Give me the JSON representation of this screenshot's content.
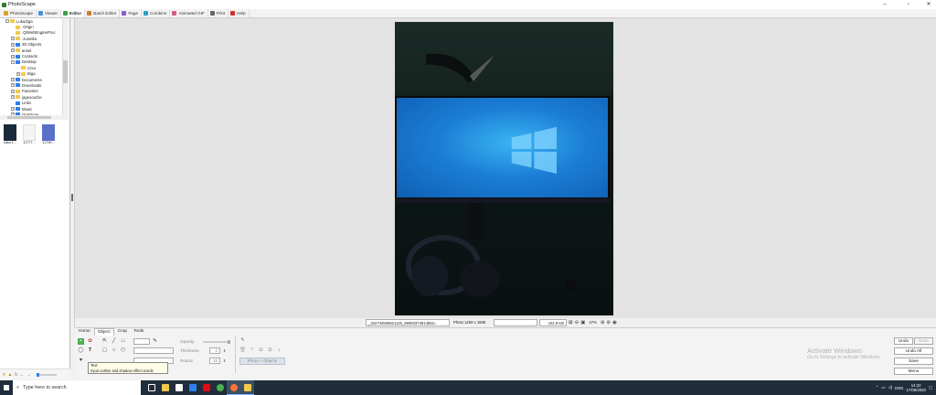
{
  "window": {
    "title": "PhotoScape",
    "minimize": "–",
    "maximize": "▫",
    "close": "✕"
  },
  "tabs": [
    {
      "label": "PhotoScape",
      "color": "#e0a030"
    },
    {
      "label": "Viewer",
      "color": "#4a90d9"
    },
    {
      "label": "Editor",
      "color": "#3aa34a",
      "active": true
    },
    {
      "label": "Batch Editor",
      "color": "#c97b2e"
    },
    {
      "label": "Page",
      "color": "#8e5bd6"
    },
    {
      "label": "Combine",
      "color": "#2e9bc9"
    },
    {
      "label": "Animated GIF",
      "color": "#d65b8e"
    },
    {
      "label": "Print",
      "color": "#666666"
    },
    {
      "label": "Help",
      "color": "#d12f2f"
    }
  ],
  "tree": [
    {
      "label": "LukaZiga",
      "indent": 1,
      "exp": "−",
      "color": "yellow"
    },
    {
      "label": ".Origin",
      "indent": 2,
      "exp": "",
      "color": "yellow"
    },
    {
      "label": ".QtWebEngineProc",
      "indent": 2,
      "exp": "",
      "color": "yellow"
    },
    {
      "label": ".zunelita",
      "indent": 2,
      "exp": "+",
      "color": "yellow"
    },
    {
      "label": "3D Objects",
      "indent": 2,
      "exp": "+",
      "color": "blue"
    },
    {
      "label": "ansel",
      "indent": 2,
      "exp": "+",
      "color": "yellow"
    },
    {
      "label": "Contacts",
      "indent": 2,
      "exp": "+",
      "color": "blue"
    },
    {
      "label": "Desktop",
      "indent": 2,
      "exp": "−",
      "color": "blue"
    },
    {
      "label": "Creo",
      "indent": 3,
      "exp": "",
      "color": "yellow"
    },
    {
      "label": "Biga",
      "indent": 3,
      "exp": "+",
      "color": "yellow"
    },
    {
      "label": "Documents",
      "indent": 2,
      "exp": "+",
      "color": "blue"
    },
    {
      "label": "Downloads",
      "indent": 2,
      "exp": "+",
      "color": "blue"
    },
    {
      "label": "Favorites",
      "indent": 2,
      "exp": "+",
      "color": "yellow"
    },
    {
      "label": "jagexcache",
      "indent": 2,
      "exp": "+",
      "color": "yellow"
    },
    {
      "label": "Links",
      "indent": 2,
      "exp": "",
      "color": "blue"
    },
    {
      "label": "Music",
      "indent": 2,
      "exp": "+",
      "color": "blue"
    },
    {
      "label": "OneDrive",
      "indent": 2,
      "exp": "+",
      "color": "blue"
    }
  ],
  "thumbnails": [
    {
      "label": "slika 1...",
      "color": "#1a2a3a"
    },
    {
      "label": "11777...",
      "color": "#f4f4f4"
    },
    {
      "label": "11790...",
      "color": "#5a6fc8"
    }
  ],
  "status": {
    "filename": "_342734556921145_86993374914852=",
    "photo": "Photo 1259 x 1688",
    "filesize": "161.8 KB",
    "zoom": "47%"
  },
  "editor": {
    "tabs": [
      "Home",
      "Object",
      "Crop",
      "Tools"
    ],
    "opacity_label": "Opacity",
    "thickness_label": "Thickness",
    "thickness_value": "2",
    "round_label": "Round",
    "round_value": "32",
    "tooltip_title": "Text",
    "tooltip_text": "Input outline and shadow effect words",
    "photo_objects": "Photo + Objects"
  },
  "right_buttons": {
    "undo": "Undo",
    "redo": "Redo",
    "undo_all": "Undo All",
    "save": "Save",
    "menu": "Menu"
  },
  "watermark": {
    "line1": "Activate Windows",
    "line2": "Go to Settings to activate Windows."
  },
  "taskbar": {
    "search_placeholder": "Type here to search",
    "apps": [
      {
        "name": "task-view",
        "color": "#ffffff"
      },
      {
        "name": "file-explorer",
        "color": "#f2c94c"
      },
      {
        "name": "store",
        "color": "#ffffff"
      },
      {
        "name": "mail",
        "color": "#2f80ed"
      },
      {
        "name": "netflix",
        "color": "#e50914"
      },
      {
        "name": "chrome",
        "color": "#4caf50"
      },
      {
        "name": "firefox",
        "color": "#ff7139"
      },
      {
        "name": "photoscape",
        "color": "#f2c94c"
      }
    ],
    "lang": "ENG",
    "time": "14:22",
    "date": "17/06/2020"
  }
}
